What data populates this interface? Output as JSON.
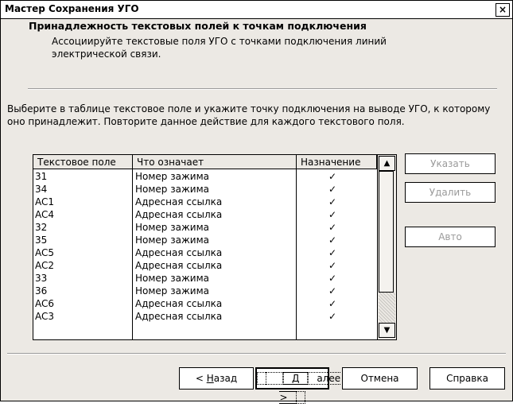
{
  "window": {
    "title": "Мастер Сохранения УГО",
    "close": "×"
  },
  "header": {
    "title": "Принадлежность текстовых полей к точкам подключения",
    "subtitle": "Ассоциируйте текстовые поля УГО с точками подключения линий электрической связи."
  },
  "instructions": "Выберите в таблице текстовое поле и укажите точку подключения на выводе УГО, к которому оно принадлежит. Повторите данное действие для каждого текстового поля.",
  "table": {
    "columns": [
      "Текстовое поле",
      "Что означает",
      "Назначение"
    ],
    "rows": [
      {
        "field": "31",
        "meaning": "Номер зажима",
        "assigned": "✓"
      },
      {
        "field": "34",
        "meaning": "Номер зажима",
        "assigned": "✓"
      },
      {
        "field": "AC1",
        "meaning": "Адресная ссылка",
        "assigned": "✓"
      },
      {
        "field": "AC4",
        "meaning": "Адресная ссылка",
        "assigned": "✓"
      },
      {
        "field": "32",
        "meaning": "Номер зажима",
        "assigned": "✓"
      },
      {
        "field": "35",
        "meaning": "Номер зажима",
        "assigned": "✓"
      },
      {
        "field": "AC5",
        "meaning": "Адресная ссылка",
        "assigned": "✓"
      },
      {
        "field": "AC2",
        "meaning": "Адресная ссылка",
        "assigned": "✓"
      },
      {
        "field": "33",
        "meaning": "Номер зажима",
        "assigned": "✓"
      },
      {
        "field": "36",
        "meaning": "Номер зажима",
        "assigned": "✓"
      },
      {
        "field": "AC6",
        "meaning": "Адресная ссылка",
        "assigned": "✓"
      },
      {
        "field": "AC3",
        "meaning": "Адресная ссылка",
        "assigned": "✓"
      }
    ]
  },
  "side_buttons": {
    "specify": "Указать",
    "delete": "Удалить",
    "auto": "Авто"
  },
  "footer": {
    "back_prefix": "< ",
    "back_mnemonic": "Н",
    "back_rest": "азад",
    "next_prefix": "",
    "next_mnemonic": "Д",
    "next_rest": "алее >",
    "cancel": "Отмена",
    "help": "Справка"
  },
  "scrollbar": {
    "up_icon": "▲",
    "down_icon": "▼"
  }
}
